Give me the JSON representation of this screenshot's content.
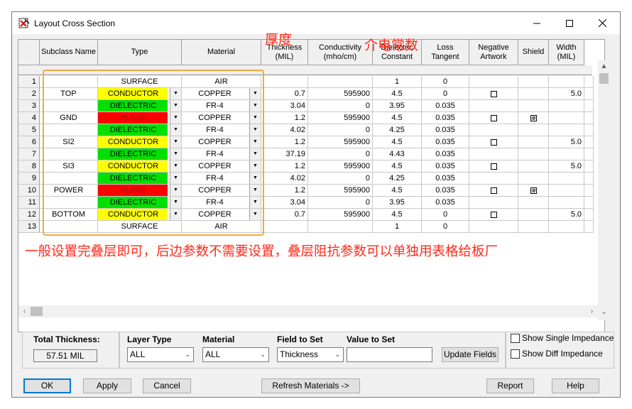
{
  "window": {
    "title": "Layout Cross Section"
  },
  "annotations": {
    "thickness_note": "厚度",
    "dielectric_note": "介电常数",
    "bottom_note": "一般设置完叠层即可，后边参数不需要设置，叠层阻抗参数可以单独用表格给板厂"
  },
  "headers": {
    "subclass": "Subclass Name",
    "type": "Type",
    "material": "Material",
    "thickness": "Thickness\n(MIL)",
    "conductivity": "Conductivity\n(mho/cm)",
    "dielectric": "Dielectric\nConstant",
    "loss": "Loss\nTangent",
    "negative": "Negative\nArtwork",
    "shield": "Shield",
    "width": "Width\n(MIL)"
  },
  "colors": {
    "conductor": "#ffff00",
    "dielectric": "#00e000",
    "plane": "#ff0000",
    "plane_text": "#a01010",
    "annotation": "#ff2a1a",
    "highlight_box": "#f3a93b"
  },
  "rows": [
    {
      "num": "1",
      "subclass": "",
      "type": "SURFACE",
      "material": "AIR",
      "thickness": "",
      "conductivity": "",
      "dielectric": "1",
      "loss": "0",
      "negative": null,
      "shield": null,
      "width": ""
    },
    {
      "num": "2",
      "subclass": "TOP",
      "type": "CONDUCTOR",
      "material": "COPPER",
      "thickness": "0.7",
      "conductivity": "595900",
      "dielectric": "4.5",
      "loss": "0",
      "negative": false,
      "shield": null,
      "width": "5.0"
    },
    {
      "num": "3",
      "subclass": "",
      "type": "DIELECTRIC",
      "material": "FR-4",
      "thickness": "3.04",
      "conductivity": "0",
      "dielectric": "3.95",
      "loss": "0.035",
      "negative": null,
      "shield": null,
      "width": ""
    },
    {
      "num": "4",
      "subclass": "GND",
      "type": "PLANE",
      "material": "COPPER",
      "thickness": "1.2",
      "conductivity": "595900",
      "dielectric": "4.5",
      "loss": "0.035",
      "negative": false,
      "shield": true,
      "width": ""
    },
    {
      "num": "5",
      "subclass": "",
      "type": "DIELECTRIC",
      "material": "FR-4",
      "thickness": "4.02",
      "conductivity": "0",
      "dielectric": "4.25",
      "loss": "0.035",
      "negative": null,
      "shield": null,
      "width": ""
    },
    {
      "num": "6",
      "subclass": "SI2",
      "type": "CONDUCTOR",
      "material": "COPPER",
      "thickness": "1.2",
      "conductivity": "595900",
      "dielectric": "4.5",
      "loss": "0.035",
      "negative": false,
      "shield": null,
      "width": "5.0"
    },
    {
      "num": "7",
      "subclass": "",
      "type": "DIELECTRIC",
      "material": "FR-4",
      "thickness": "37.19",
      "conductivity": "0",
      "dielectric": "4.43",
      "loss": "0.035",
      "negative": null,
      "shield": null,
      "width": ""
    },
    {
      "num": "8",
      "subclass": "SI3",
      "type": "CONDUCTOR",
      "material": "COPPER",
      "thickness": "1.2",
      "conductivity": "595900",
      "dielectric": "4.5",
      "loss": "0.035",
      "negative": false,
      "shield": null,
      "width": "5.0"
    },
    {
      "num": "9",
      "subclass": "",
      "type": "DIELECTRIC",
      "material": "FR-4",
      "thickness": "4.02",
      "conductivity": "0",
      "dielectric": "4.25",
      "loss": "0.035",
      "negative": null,
      "shield": null,
      "width": ""
    },
    {
      "num": "10",
      "subclass": "POWER",
      "type": "PLANE",
      "material": "COPPER",
      "thickness": "1.2",
      "conductivity": "595900",
      "dielectric": "4.5",
      "loss": "0.035",
      "negative": false,
      "shield": true,
      "width": ""
    },
    {
      "num": "11",
      "subclass": "",
      "type": "DIELECTRIC",
      "material": "FR-4",
      "thickness": "3.04",
      "conductivity": "0",
      "dielectric": "3.95",
      "loss": "0.035",
      "negative": null,
      "shield": null,
      "width": ""
    },
    {
      "num": "12",
      "subclass": "BOTTOM",
      "type": "CONDUCTOR",
      "material": "COPPER",
      "thickness": "0.7",
      "conductivity": "595900",
      "dielectric": "4.5",
      "loss": "0",
      "negative": false,
      "shield": null,
      "width": "5.0"
    },
    {
      "num": "13",
      "subclass": "",
      "type": "SURFACE",
      "material": "AIR",
      "thickness": "",
      "conductivity": "",
      "dielectric": "1",
      "loss": "0",
      "negative": null,
      "shield": null,
      "width": ""
    }
  ],
  "footer": {
    "total_thickness_label": "Total Thickness:",
    "total_thickness_value": "57.51 MIL",
    "layer_type_label": "Layer Type",
    "layer_type_value": "ALL",
    "material_label": "Material",
    "material_value": "ALL",
    "field_to_set_label": "Field to Set",
    "field_to_set_value": "Thickness",
    "value_to_set_label": "Value to Set",
    "value_to_set_value": "",
    "update_fields": "Update Fields",
    "show_single_impedance": "Show Single Impedance",
    "show_diff_impedance": "Show Diff Impedance"
  },
  "buttons": {
    "ok": "OK",
    "apply": "Apply",
    "cancel": "Cancel",
    "refresh": "Refresh Materials ->",
    "report": "Report",
    "help": "Help"
  }
}
